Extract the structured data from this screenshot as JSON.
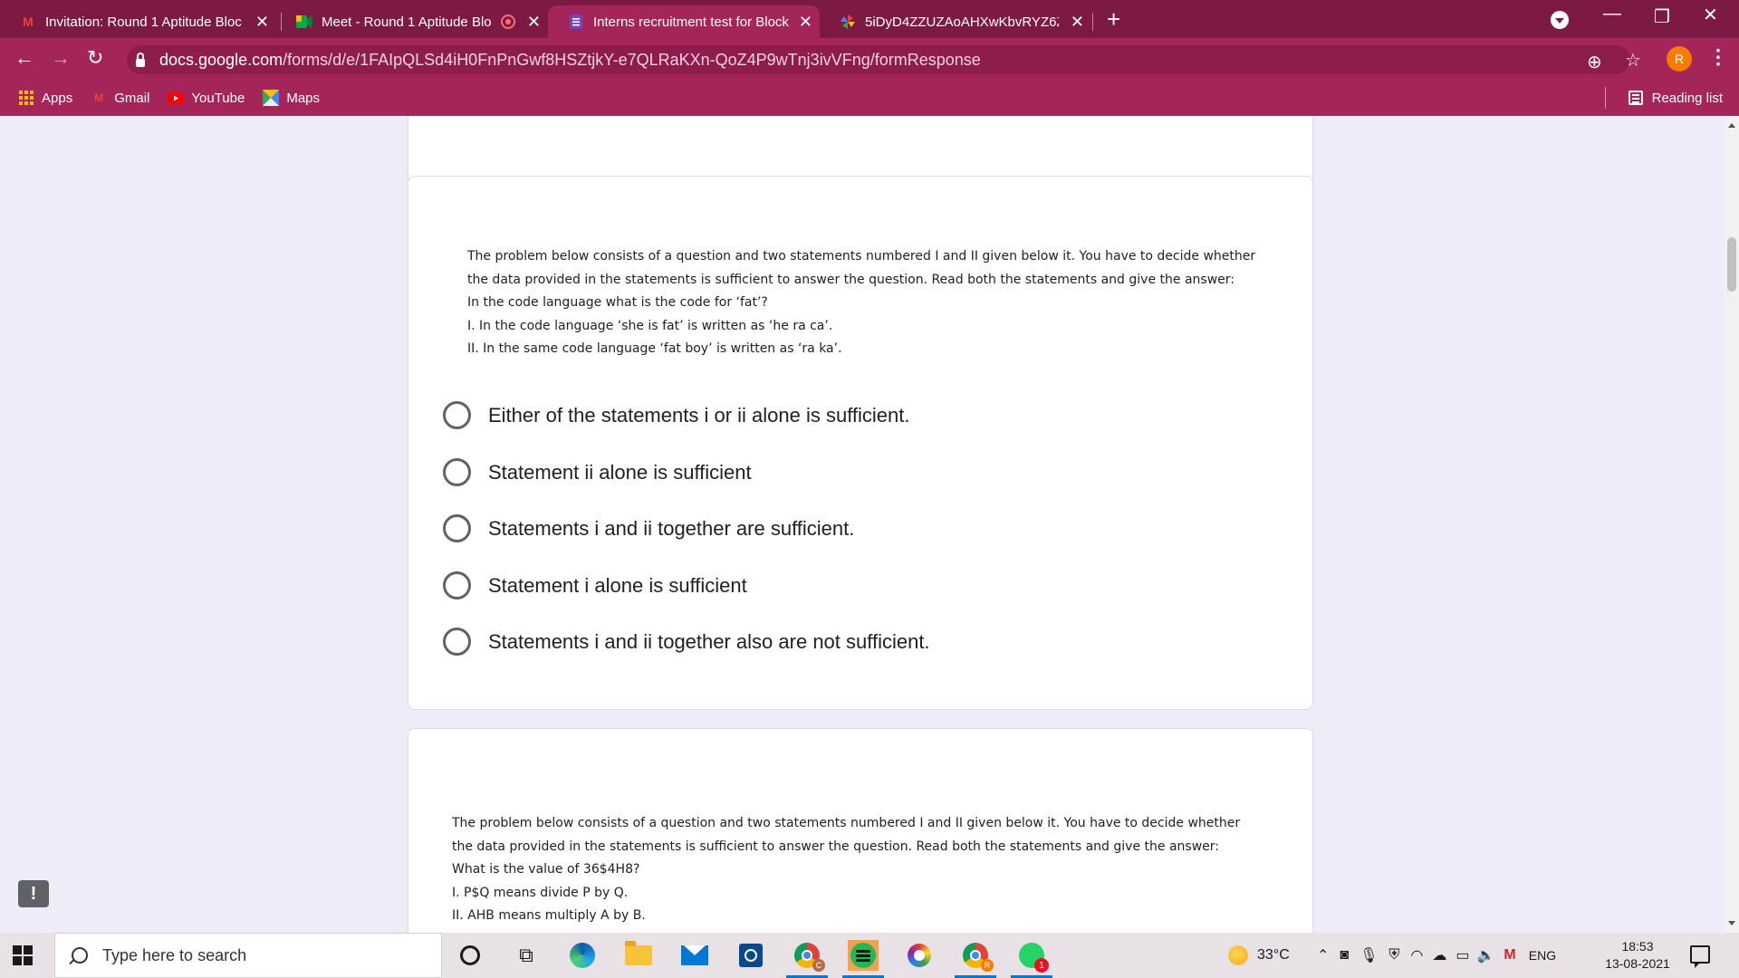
{
  "browser": {
    "tabs": [
      {
        "title": "Invitation: Round 1 Aptitude Bloc",
        "icon": "gmail-icon",
        "active": false
      },
      {
        "title": "Meet - Round 1 Aptitude Blo",
        "icon": "google-meet-icon",
        "active": false,
        "recording": true
      },
      {
        "title": "Interns recruitment test for Block",
        "icon": "google-forms-icon",
        "active": true
      },
      {
        "title": "5iDyD4ZZUZAoAHXwKbvRYZ6ZL",
        "icon": "pinwheel-icon",
        "active": false
      }
    ],
    "url_host": "docs.google.com",
    "url_path": "/forms/d/e/1FAIpQLSd4iH0FnPnGwf8HSZtjkY-e7QLRaKXn-QoZ4P9wTnj3ivVFng/formResponse",
    "profile_initial": "R",
    "bookmarks": [
      "Apps",
      "Gmail",
      "YouTube",
      "Maps"
    ],
    "reading_list": "Reading list"
  },
  "form": {
    "question1": {
      "lines": [
        "The problem below consists of a question and two statements numbered I and II given below it. You have to decide whether",
        "the data provided in the statements is sufficient to answer the question. Read both the statements and give the answer:",
        "In the code language what is the code for ‘fat’?",
        "I. In the code language ‘she is fat’ is written as ‘he ra ca’.",
        "II. In the same code language ‘fat boy’ is written as ‘ra ka’."
      ],
      "options": [
        "Either of the statements i or ii alone is sufficient.",
        "Statement ii alone is sufficient",
        "Statements i and ii together are sufficient.",
        "Statement i alone is sufficient",
        "Statements i and ii together also are not sufficient."
      ]
    },
    "question2": {
      "lines": [
        "The problem below consists of a question and two statements numbered I and II given below it. You have to decide whether",
        "the data provided in the statements is sufficient to answer the question. Read both the statements and give the answer:",
        "What is the value of 36$4H8?",
        "I.  P$Q means divide P by Q.",
        " II. AHB means multiply A by B."
      ]
    }
  },
  "taskbar": {
    "search_placeholder": "Type here to search",
    "temperature": "33°C",
    "language": "ENG",
    "time": "18:53",
    "date": "13-08-2021",
    "whatsapp_badge": "1"
  },
  "colors": {
    "tab_strip": "#7d1a44",
    "toolbar": "#a3255a",
    "page_bg": "#f0ebf8"
  }
}
